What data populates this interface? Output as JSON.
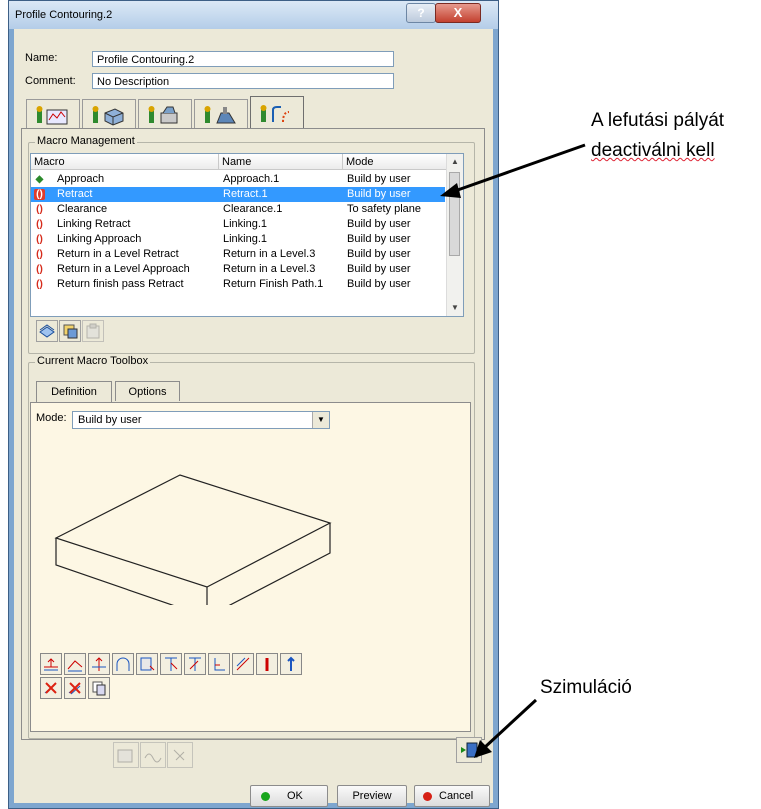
{
  "window": {
    "title": "Profile Contouring.2",
    "help": "?",
    "close": "X"
  },
  "form": {
    "name_label": "Name:",
    "name_value": "Profile Contouring.2",
    "comment_label": "Comment:",
    "comment_value": "No Description"
  },
  "tabs": [
    {
      "icon": "strategy-icon",
      "active": false
    },
    {
      "icon": "geometry-icon",
      "active": false
    },
    {
      "icon": "tool-icon",
      "active": false
    },
    {
      "icon": "feeds-speeds-icon",
      "active": false
    },
    {
      "icon": "macros-icon",
      "active": true
    }
  ],
  "macro_management": {
    "title": "Macro Management",
    "columns": [
      "Macro",
      "Name",
      "Mode"
    ],
    "rows": [
      {
        "macro": "Approach",
        "name": "Approach.1",
        "mode": "Build by user",
        "icon": "green"
      },
      {
        "macro": "Retract",
        "name": "Retract.1",
        "mode": "Build by user",
        "icon": "red",
        "selected": true
      },
      {
        "macro": "Clearance",
        "name": "Clearance.1",
        "mode": "To safety plane",
        "icon": "red"
      },
      {
        "macro": "Linking Retract",
        "name": "Linking.1",
        "mode": "Build by user",
        "icon": "red"
      },
      {
        "macro": "Linking Approach",
        "name": "Linking.1",
        "mode": "Build by user",
        "icon": "red"
      },
      {
        "macro": "Return in a Level Retract",
        "name": "Return in a Level.3",
        "mode": "Build by user",
        "icon": "red"
      },
      {
        "macro": "Return in a Level Approach",
        "name": "Return in a Level.3",
        "mode": "Build by user",
        "icon": "red"
      },
      {
        "macro": "Return finish pass Retract",
        "name": "Return Finish Path.1",
        "mode": "Build by user",
        "icon": "red"
      }
    ]
  },
  "current_macro_toolbox": {
    "title": "Current Macro Toolbox",
    "tabs": [
      "Definition",
      "Options"
    ],
    "mode_label": "Mode:",
    "mode_value": "Build by user"
  },
  "buttons": {
    "ok": "OK",
    "preview": "Preview",
    "cancel": "Cancel"
  },
  "annotations": {
    "deactivate_line1": "A lefutási pályát",
    "deactivate_line2": "deactiválni kell",
    "simulation": "Szimuláció"
  },
  "colors": {
    "selection": "#3399ff",
    "title_bar": "#b4cde8",
    "dialog_bg": "#ece9d8",
    "canvas_bg": "#fdf7e4"
  }
}
